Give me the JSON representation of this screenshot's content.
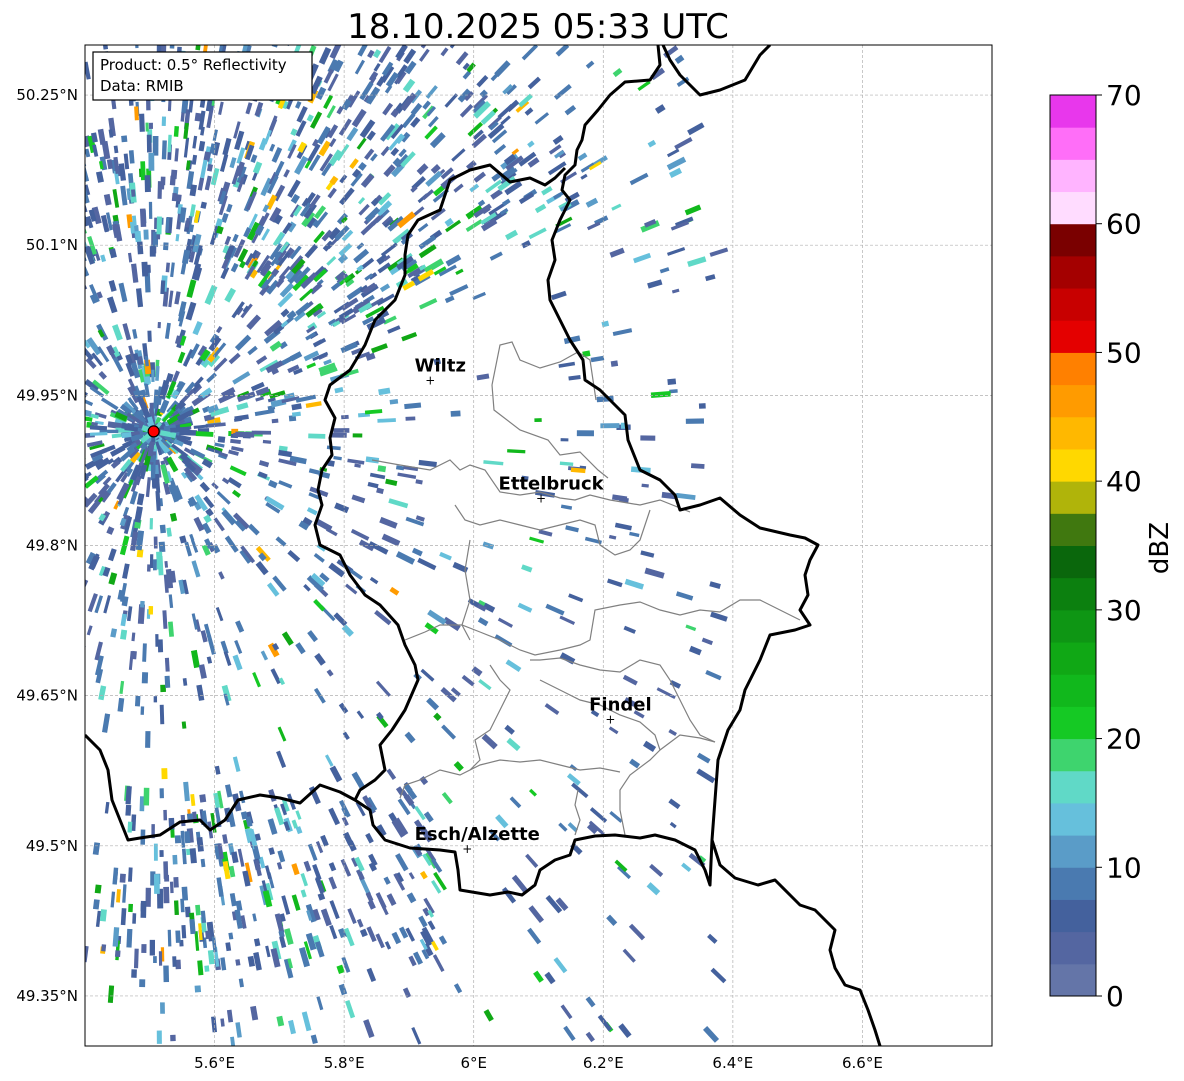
{
  "title": "18.10.2025 05:33 UTC",
  "info_box": {
    "product": "Product: 0.5° Reflectivity",
    "data": "Data: RMIB"
  },
  "map_extent": {
    "lon_min": 5.4,
    "lon_max": 6.8,
    "lat_min": 49.3,
    "lat_max": 50.3
  },
  "lat_ticks": [
    {
      "value": 50.25,
      "label": "50.25°N"
    },
    {
      "value": 50.1,
      "label": "50.1°N"
    },
    {
      "value": 49.95,
      "label": "49.95°N"
    },
    {
      "value": 49.8,
      "label": "49.8°N"
    },
    {
      "value": 49.65,
      "label": "49.65°N"
    },
    {
      "value": 49.5,
      "label": "49.5°N"
    },
    {
      "value": 49.35,
      "label": "49.35°N"
    }
  ],
  "lon_ticks": [
    {
      "value": 5.6,
      "label": "5.6°E"
    },
    {
      "value": 5.8,
      "label": "5.8°E"
    },
    {
      "value": 6.0,
      "label": "6°E"
    },
    {
      "value": 6.2,
      "label": "6.2°E"
    },
    {
      "value": 6.4,
      "label": "6.4°E"
    },
    {
      "value": 6.6,
      "label": "6.6°E"
    }
  ],
  "radar_site": {
    "lon": 5.506,
    "lat": 49.914
  },
  "cities": [
    {
      "name": "Wiltz",
      "lon": 5.933,
      "lat": 49.966
    },
    {
      "name": "Ettelbruck",
      "lon": 6.104,
      "lat": 49.848
    },
    {
      "name": "Findel",
      "lon": 6.211,
      "lat": 49.627
    },
    {
      "name": "Esch/Alzette",
      "lon": 5.99,
      "lat": 49.498
    }
  ],
  "colorbar": {
    "label": "dBZ",
    "min": 0,
    "max": 70,
    "ticks": [
      0,
      10,
      20,
      30,
      40,
      50,
      60,
      70
    ],
    "colors": [
      "#6475a8",
      "#5466a1",
      "#44619d",
      "#4a7ab0",
      "#5a9cc8",
      "#66c0dc",
      "#60d9c7",
      "#3ed46e",
      "#15c924",
      "#11b81c",
      "#10a815",
      "#0e9614",
      "#0c800f",
      "#0a670c",
      "#40780f",
      "#b0b40a",
      "#ffd800",
      "#ffb800",
      "#ff9b00",
      "#ff8000",
      "#e40000",
      "#c80000",
      "#a40000",
      "#7a0000",
      "#ffdcff",
      "#ffb4ff",
      "#ff6ef8",
      "#e837ec"
    ]
  },
  "colors": {
    "border_country": "#000000",
    "border_canton": "#808080",
    "radar_marker": "#ff0000"
  }
}
